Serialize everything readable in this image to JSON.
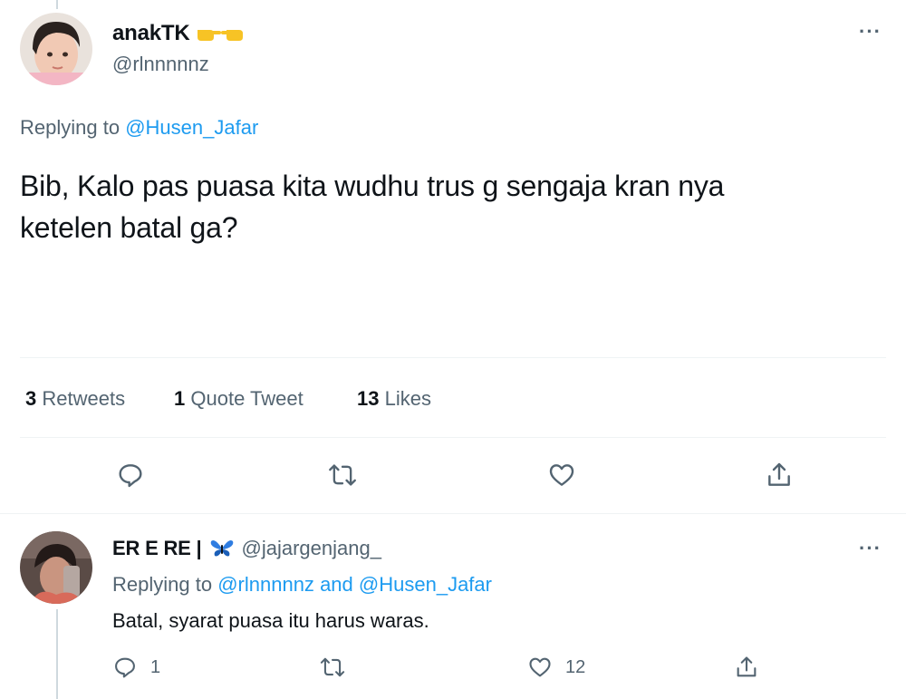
{
  "tweet": {
    "author_name": "anakTK",
    "author_handle": "@rlnnnnnz",
    "replying_prefix": "Replying to",
    "replying_to": "@Husen_Jafar",
    "text_line1": "Bib, Kalo pas puasa kita wudhu trus g sengaja kran nya",
    "text_line2": "ketelen batal ga?",
    "stats": {
      "retweets_count": "3",
      "retweets_label": "Retweets",
      "quotes_count": "1",
      "quotes_label": "Quote Tweet",
      "likes_count": "13",
      "likes_label": "Likes"
    },
    "actions": [
      "reply",
      "retweet",
      "like",
      "share"
    ]
  },
  "reply": {
    "author_name": "ER E RE |",
    "author_handle": "@jajargenjang_",
    "replying_prefix": "Replying to",
    "replying_to_1": "@rlnnnnnz",
    "replying_and": "and",
    "replying_to_2": "@Husen_Jafar",
    "text": "Batal, syarat puasa itu harus waras.",
    "reply_count": "1",
    "like_count": "12"
  },
  "more_label": "···",
  "colors": {
    "link": "#1d9bf0",
    "secondary": "#536471",
    "divider": "#eff3f4",
    "emoji_yellow": "#f7c325",
    "butterfly_blue": "#2f7de1"
  }
}
